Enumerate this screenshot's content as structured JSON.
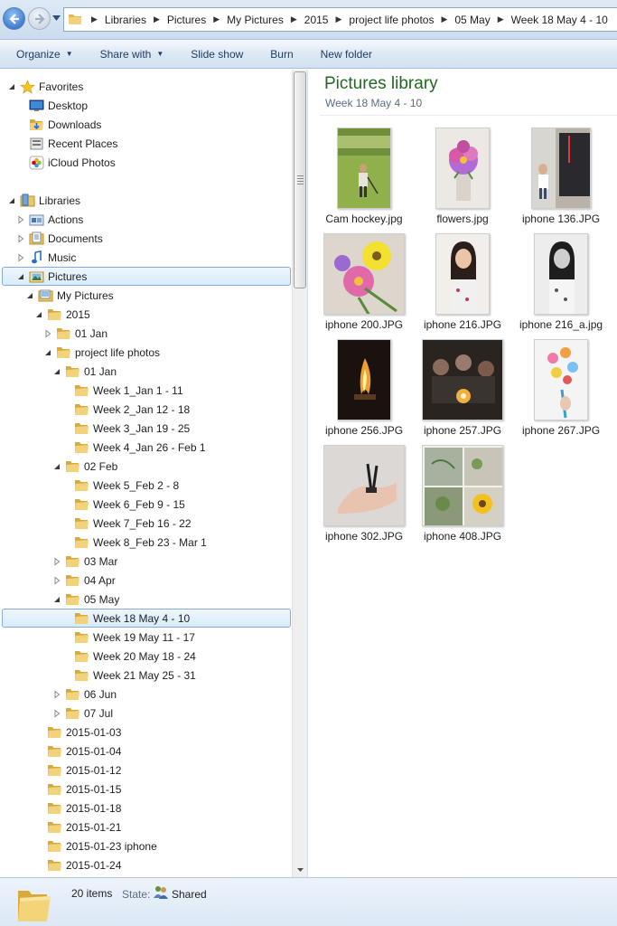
{
  "breadcrumb": [
    "Libraries",
    "Pictures",
    "My Pictures",
    "2015",
    "project life photos",
    "05 May",
    "Week 18 May 4 - 10"
  ],
  "toolbar": {
    "organize": "Organize",
    "share_with": "Share with",
    "slide_show": "Slide show",
    "burn": "Burn",
    "new_folder": "New folder"
  },
  "nav": {
    "favorites": {
      "label": "Favorites",
      "items": [
        "Desktop",
        "Downloads",
        "Recent Places",
        "iCloud Photos"
      ]
    },
    "libraries": {
      "label": "Libraries",
      "items": [
        "Actions",
        "Documents",
        "Music",
        "Pictures"
      ]
    },
    "my_pictures": "My Pictures",
    "year_2015": "2015",
    "jan_01": "01 Jan",
    "project_life": "project life photos",
    "pl_jan": "01 Jan",
    "jan_weeks": [
      "Week 1_Jan 1 - 11",
      "Week 2_Jan 12 - 18",
      "Week 3_Jan 19 - 25",
      "Week 4_Jan 26 - Feb 1"
    ],
    "pl_feb": "02 Feb",
    "feb_weeks": [
      "Week 5_Feb 2 - 8",
      "Week 6_Feb 9 - 15",
      "Week 7_Feb 16 - 22",
      "Week 8_Feb 23 - Mar 1"
    ],
    "pl_mar": "03 Mar",
    "pl_apr": "04 Apr",
    "pl_may": "05 May",
    "may_weeks": [
      "Week 18 May 4 - 10",
      "Week 19 May 11 - 17",
      "Week 20 May 18 - 24",
      "Week 21 May 25 - 31"
    ],
    "pl_jun": "06 Jun",
    "pl_jul": "07 Jul",
    "date_folders": [
      "2015-01-03",
      "2015-01-04",
      "2015-01-12",
      "2015-01-15",
      "2015-01-18",
      "2015-01-21",
      "2015-01-23 iphone",
      "2015-01-24"
    ]
  },
  "content": {
    "title": "Pictures library",
    "subtitle": "Week 18 May 4 - 10",
    "files": [
      {
        "name": "Cam hockey.jpg"
      },
      {
        "name": "flowers.jpg"
      },
      {
        "name": "iphone 136.JPG"
      },
      {
        "name": "iphone 200.JPG"
      },
      {
        "name": "iphone 216.JPG"
      },
      {
        "name": "iphone 216_a.jpg"
      },
      {
        "name": "iphone 256.JPG"
      },
      {
        "name": "iphone 257.JPG"
      },
      {
        "name": "iphone 267.JPG"
      },
      {
        "name": "iphone 302.JPG"
      },
      {
        "name": "iphone 408.JPG"
      }
    ]
  },
  "details": {
    "item_count": "20 items",
    "state_label": "State:",
    "state_value": "Shared"
  },
  "colors": {
    "library_title": "#1e6a1e",
    "selection_border": "#84acdd",
    "folder": "#e8c45a"
  }
}
